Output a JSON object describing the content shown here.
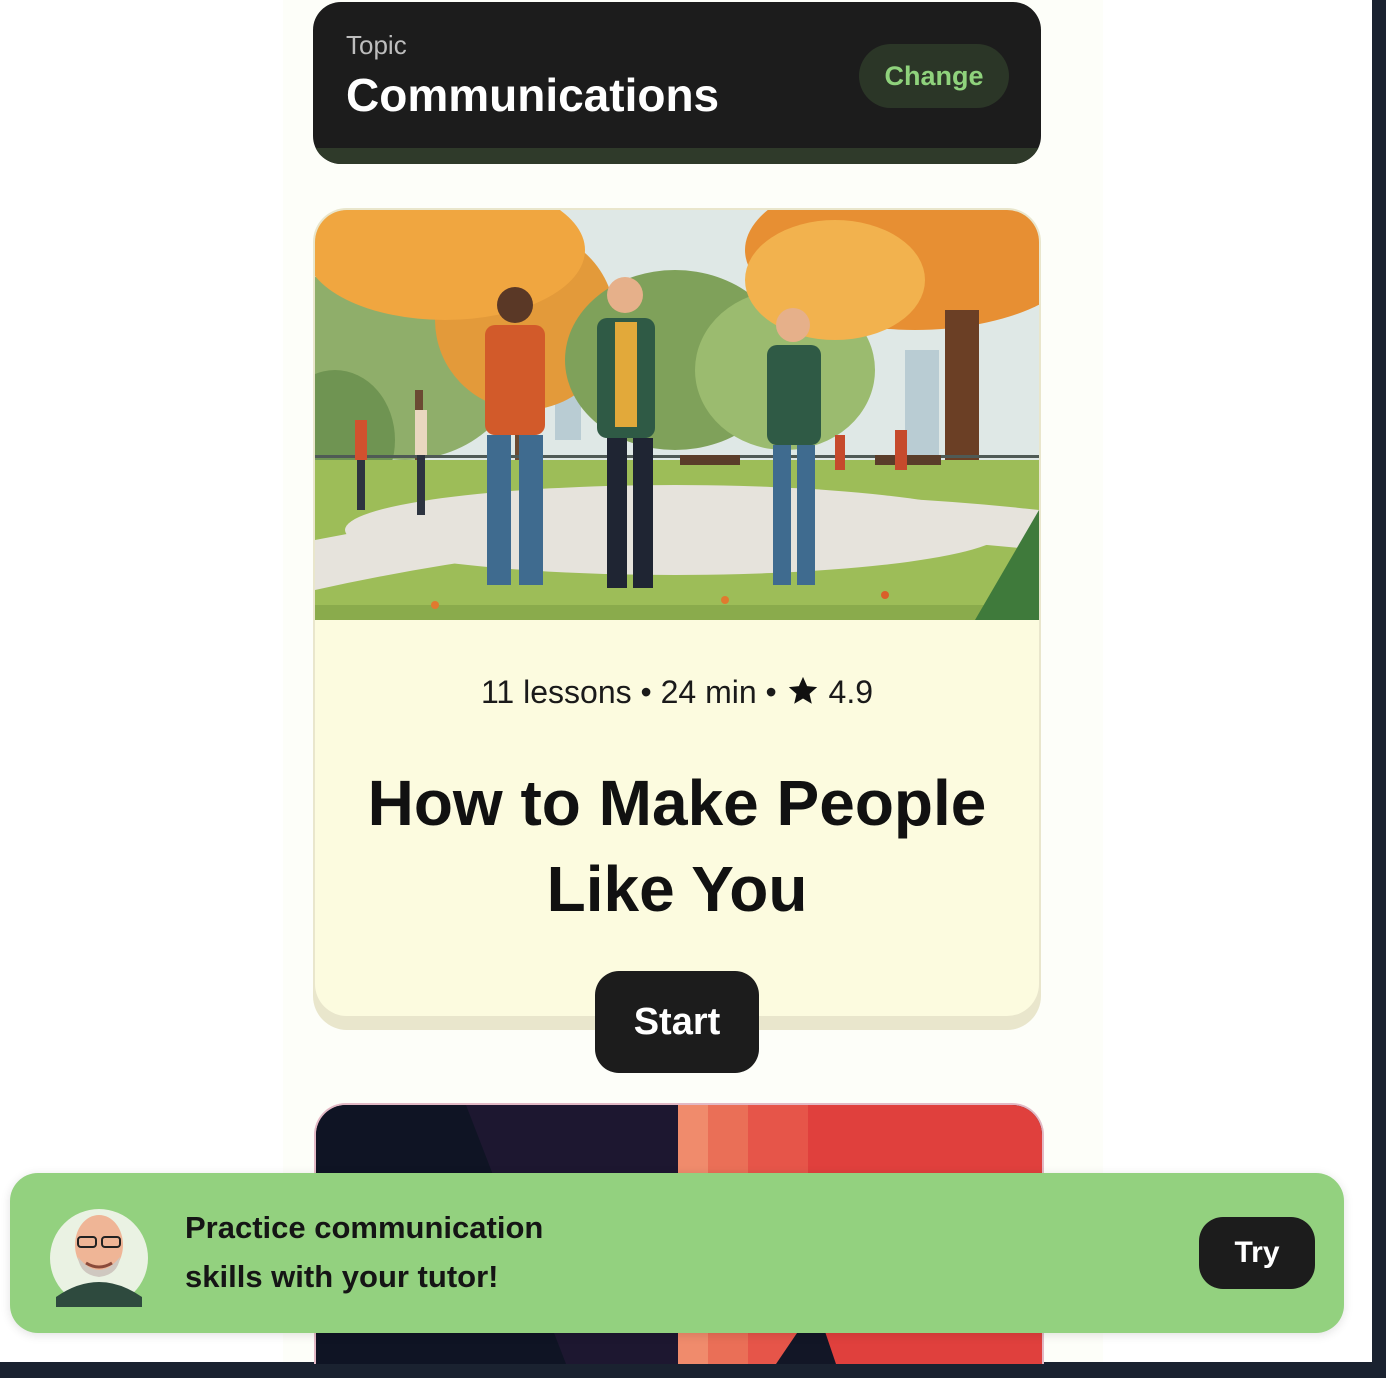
{
  "topic": {
    "label": "Topic",
    "title": "Communications",
    "change_label": "Change"
  },
  "course": {
    "lessons": "11 lessons",
    "duration": "24 min",
    "rating": "4.9",
    "separator": "•",
    "title_line1": "How to Make People",
    "title_line2": "Like You",
    "start_label": "Start",
    "image": "illustration of three people meeting in an autumn park"
  },
  "banner": {
    "line1": "Practice communication",
    "line2": "skills with your tutor!",
    "try_label": "Try",
    "avatar": "tutor-avatar"
  },
  "colors": {
    "banner_bg": "#93d17f",
    "dark": "#1c1c1c",
    "change_text": "#8fd27c",
    "course_bg": "#fcfbdf"
  }
}
